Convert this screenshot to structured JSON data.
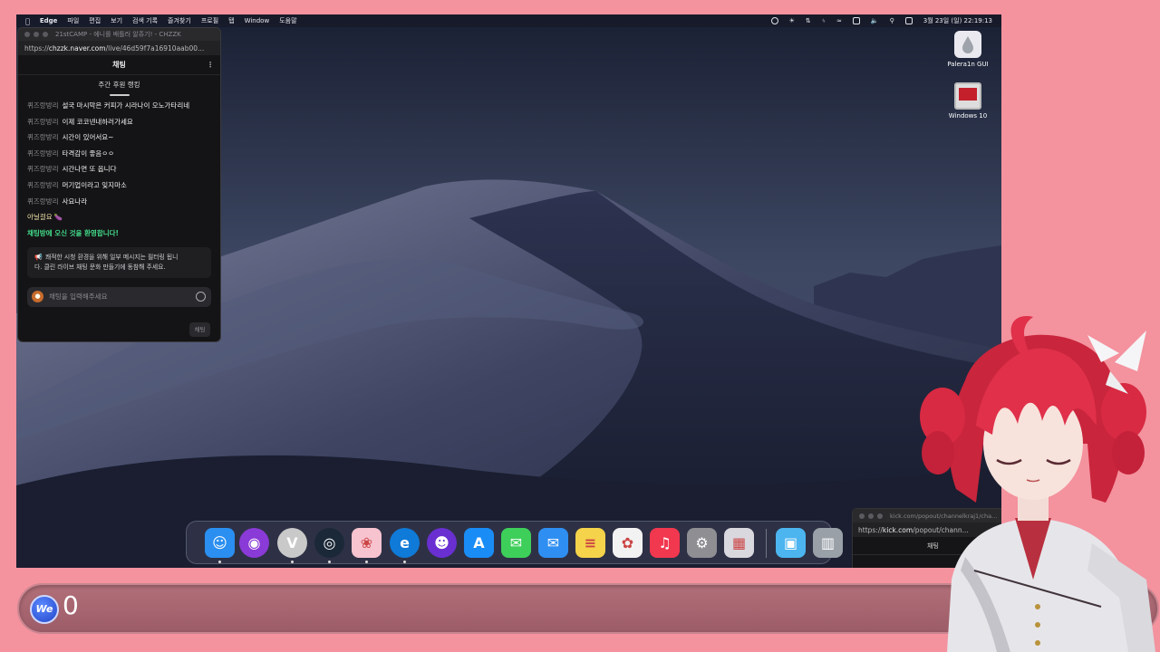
{
  "menubar": {
    "app": "Edge",
    "items": [
      "파일",
      "편집",
      "보기",
      "검색 기록",
      "즐겨찾기",
      "프로필",
      "탭",
      "Window",
      "도움말"
    ],
    "datetime": "3월 23일 (일)  22:19:13"
  },
  "desktop_icons": [
    {
      "label": "Palera1n GUI",
      "icon": "palera1n-drop-icon"
    },
    {
      "label": "Windows 10",
      "icon": "parallels-windows-icon"
    }
  ],
  "chat_window": {
    "title": "21stCAMP - 에니를 배틀러 알쥬기! - CHZZK",
    "url_prefix": "https://",
    "url_domain": "chzzk.naver.com",
    "url_rest": "/live/46d59f7a16910aab00...",
    "header": "채팅",
    "ranking_tab": "주간 후원 랭킹",
    "messages": [
      {
        "nick": "퀴즈랑방리",
        "text": "설국 마시막은 커피가 시라나이 오노가타리네"
      },
      {
        "nick": "퀴즈랑방리",
        "text": "이제 코코넨내하러가세요"
      },
      {
        "nick": "퀴즈랑방리",
        "text": "시간이 있어서요~"
      },
      {
        "nick": "퀴즈랑방리",
        "text": "타격감이 좋음ㅇㅇ"
      },
      {
        "nick": "퀴즈랑방리",
        "text": "시간나면 또 옵니다"
      },
      {
        "nick": "퀴즈랑방리",
        "text": "머기업이라고 잊지마소"
      },
      {
        "nick": "퀴즈랑방리",
        "text": "사요나라"
      },
      {
        "nick": "아닐걸요",
        "text": "🍆"
      }
    ],
    "welcome": "채팅방에 오신 것을 환영합니다!",
    "notice_line1": "쾌적한 시청 환경을 위해 일부 메시지는 필터링 됩니",
    "notice_line2": "다. 클린 라이브 채팅 문화 만들기에 동참해 주세요.",
    "input_placeholder": "채팅을 입력해주세요",
    "send_label": "채팅"
  },
  "kick_window": {
    "title": "kick.com/popout/channelkraj1/cha...",
    "url_prefix": "https://",
    "url_domain": "kick.com",
    "url_rest": "/popout/chann...",
    "header": "채팅"
  },
  "dock_apps": [
    {
      "name": "Finder",
      "icon": "finder-icon",
      "color": "#2a8ff0",
      "running": true
    },
    {
      "name": "Siri",
      "icon": "siri-icon",
      "color": "#8a3ad6",
      "running": false
    },
    {
      "name": "Vivaldi",
      "icon": "vivaldi-icon",
      "color": "#c9c9c9",
      "running": true
    },
    {
      "name": "Steam",
      "icon": "steam-icon",
      "color": "#1b2838",
      "running": true
    },
    {
      "name": "Pink app",
      "icon": "pink-petal-icon",
      "color": "#f7c3cf",
      "running": true
    },
    {
      "name": "Edge",
      "icon": "edge-icon",
      "color": "#0f7ad8",
      "running": true
    },
    {
      "name": "Ghost app",
      "icon": "ghost-icon",
      "color": "#6a2fd1",
      "running": false
    },
    {
      "name": "App Store",
      "icon": "app-store-icon",
      "color": "#1a8cf5",
      "running": false
    },
    {
      "name": "Messages",
      "icon": "messages-icon",
      "color": "#3ecf5a",
      "running": false
    },
    {
      "name": "Mail",
      "icon": "mail-icon",
      "color": "#2f8ef2",
      "running": false
    },
    {
      "name": "Notes",
      "icon": "notes-icon",
      "color": "#f5d34a",
      "running": false
    },
    {
      "name": "Photos",
      "icon": "photos-icon",
      "color": "#f2f2f2",
      "running": false
    },
    {
      "name": "Music",
      "icon": "music-icon",
      "color": "#f2384f",
      "running": false
    },
    {
      "name": "System Settings",
      "icon": "gear-icon",
      "color": "#8e8e93",
      "running": false
    },
    {
      "name": "Launchpad",
      "icon": "launchpad-icon",
      "color": "#d8d8de",
      "running": false
    },
    {
      "name": "Downloads",
      "icon": "folder-icon",
      "color": "#4cb5f0",
      "running": false
    },
    {
      "name": "Trash",
      "icon": "trash-icon",
      "color": "#9aa0a8",
      "running": false
    }
  ],
  "overlay": {
    "counter": "0",
    "logo_text": "We"
  }
}
